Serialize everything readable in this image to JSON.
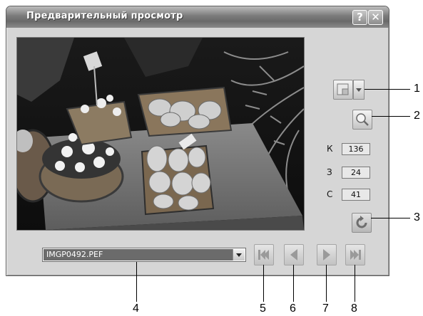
{
  "window": {
    "title": "Предварительный просмотр",
    "help_label": "?",
    "close_label": "✕"
  },
  "preview": {
    "image_description_icon": "photo-preview"
  },
  "color_readout": {
    "red_label": "К",
    "red_value": "136",
    "green_label": "З",
    "green_value": "24",
    "blue_label": "С",
    "blue_value": "41"
  },
  "file_select": {
    "selected": "IMGP0492.PEF"
  },
  "callouts": [
    "1",
    "2",
    "3",
    "4",
    "5",
    "6",
    "7",
    "8"
  ]
}
